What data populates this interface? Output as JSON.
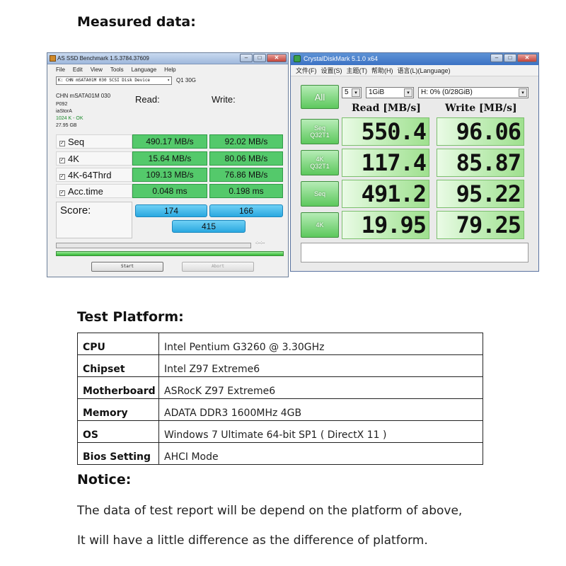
{
  "headings": {
    "measured": "Measured data:",
    "platform": "Test Platform:",
    "notice": "Notice:"
  },
  "asssd": {
    "title": "AS SSD Benchmark 1.5.3784.37609",
    "menu": [
      "File",
      "Edit",
      "View",
      "Tools",
      "Language",
      "Help"
    ],
    "drive": "K: CHN mSATA01M 030 SCSI Disk Device",
    "size": "Q1 30G",
    "info": {
      "model": "CHN mSATA01M 030",
      "fw": "P092",
      "driver": "iaStorA",
      "align": "1024 K - OK",
      "capacity": "27.95 GB"
    },
    "read_label": "Read:",
    "write_label": "Write:",
    "rows": [
      {
        "label": "Seq",
        "read": "490.17 MB/s",
        "write": "92.02 MB/s"
      },
      {
        "label": "4K",
        "read": "15.64 MB/s",
        "write": "80.06 MB/s"
      },
      {
        "label": "4K-64Thrd",
        "read": "109.13 MB/s",
        "write": "76.86 MB/s"
      },
      {
        "label": "Acc.time",
        "read": "0.048 ms",
        "write": "0.198 ms"
      }
    ],
    "score_label": "Score:",
    "score_read": "174",
    "score_write": "166",
    "score_total": "415",
    "timer": "-:--:--",
    "start_label": "Start",
    "abort_label": "Abort",
    "check": "✓"
  },
  "cdm": {
    "title": "CrystalDiskMark 5.1.0 x64",
    "menu": [
      "文件(F)",
      "设置(S)",
      "主题(T)",
      "帮助(H)",
      "语言(L)(Language)"
    ],
    "all_label": "All",
    "count": "5",
    "size": "1GiB",
    "drive": "H: 0% (0/28GiB)",
    "read_head": "Read [MB/s]",
    "write_head": "Write [MB/s]",
    "rows": [
      {
        "l1": "Seq",
        "l2": "Q32T1",
        "read": "550.4",
        "write": "96.06"
      },
      {
        "l1": "4K",
        "l2": "Q32T1",
        "read": "117.4",
        "write": "85.87"
      },
      {
        "l1": "Seq",
        "l2": "",
        "read": "491.2",
        "write": "95.22"
      },
      {
        "l1": "4K",
        "l2": "",
        "read": "19.95",
        "write": "79.25"
      }
    ]
  },
  "platform": [
    {
      "key": "CPU",
      "value": "Intel Pentium G3260 @ 3.30GHz"
    },
    {
      "key": "Chipset",
      "value": "Intel Z97 Extreme6"
    },
    {
      "key": "Motherboard",
      "value": "ASRocK Z97 Extreme6"
    },
    {
      "key": "Memory",
      "value": "ADATA DDR3 1600MHz 4GB"
    },
    {
      "key": "OS",
      "value": "Windows 7 Ultimate 64-bit SP1 ( DirectX 11 )"
    },
    {
      "key": "Bios Setting",
      "value": "AHCI Mode"
    }
  ],
  "notice": [
    "The data of test report will be depend on the platform of above,",
    "It will have a little difference as the difference of platform."
  ],
  "window_buttons": {
    "min": "–",
    "max": "□",
    "close": "✕"
  },
  "dropdown_arrow": "▾"
}
